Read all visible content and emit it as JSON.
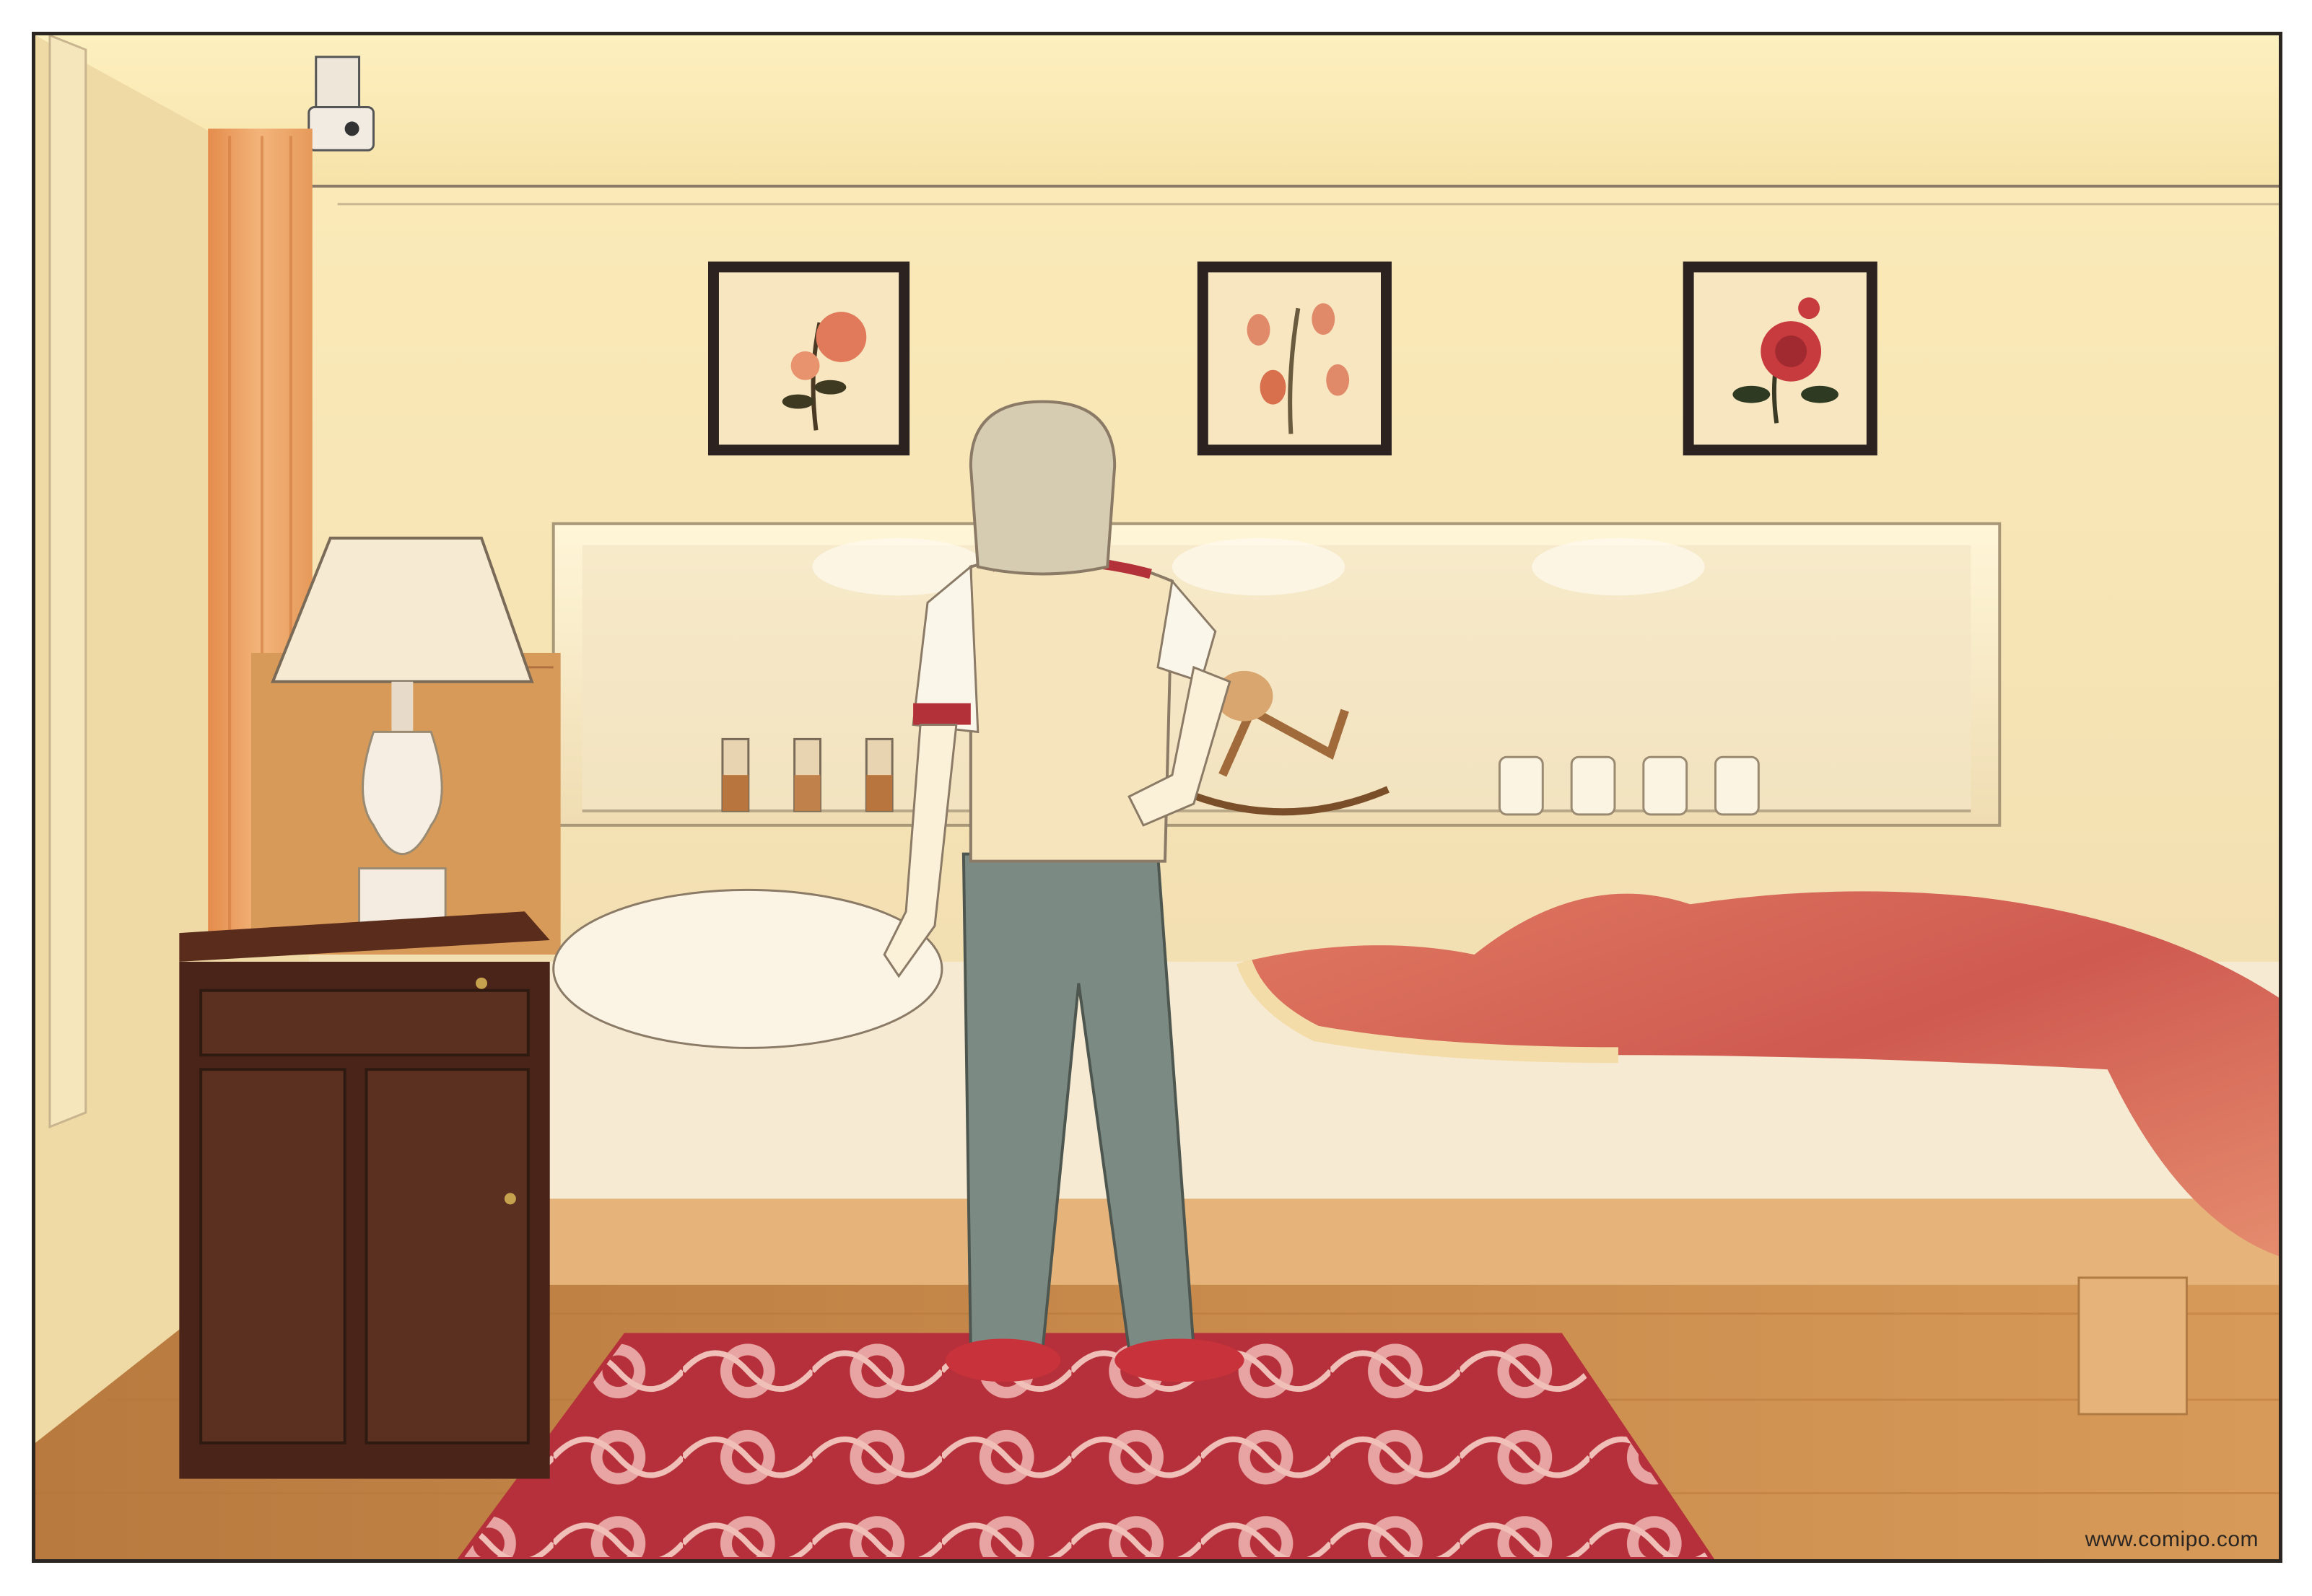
{
  "panel": {
    "watermark": "www.comipo.com"
  },
  "scene": {
    "setting": "bedroom",
    "character": "boy-back-view",
    "frames": [
      {
        "flower": "pink-lily"
      },
      {
        "flower": "orange-bells"
      },
      {
        "flower": "red-rose"
      }
    ],
    "shelf_items": [
      "spice-bottles",
      "rocking-horse",
      "glass-jars"
    ],
    "colors": {
      "wall": "#f4e2b0",
      "curtain": "#e9a060",
      "floor": "#c98a4a",
      "rug": "#b8323c",
      "nightstand": "#4a2418",
      "blanket": "#d86a5a",
      "pants": "#7c8a84"
    }
  }
}
